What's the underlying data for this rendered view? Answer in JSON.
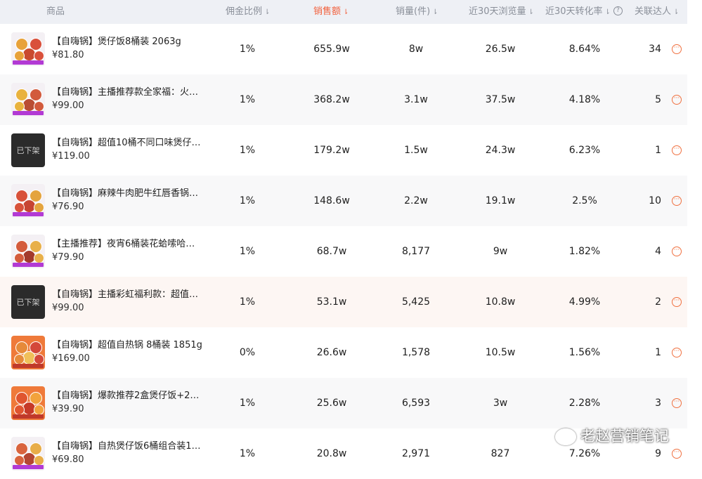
{
  "header": {
    "product": "商品",
    "commission": "佣金比例",
    "sales_amount": "销售额",
    "sales_volume": "销量(件)",
    "views_30d": "近30天浏览量",
    "conversion_30d": "近30天转化率",
    "related_kols": "关联达人"
  },
  "rows": [
    {
      "title": "【自嗨锅】煲仔饭8桶装 2063g",
      "price": "¥81.80",
      "commission": "1%",
      "sales_amount": "655.9w",
      "sales_volume": "8w",
      "views": "26.5w",
      "conversion": "8.64%",
      "kols": "34"
    },
    {
      "title": "【自嗨锅】主播推荐款全家福：火…",
      "price": "¥99.00",
      "commission": "1%",
      "sales_amount": "368.2w",
      "sales_volume": "3.1w",
      "views": "37.5w",
      "conversion": "4.18%",
      "kols": "5"
    },
    {
      "title": "【自嗨锅】超值10桶不同口味煲仔…",
      "price": "¥119.00",
      "commission": "1%",
      "sales_amount": "179.2w",
      "sales_volume": "1.5w",
      "views": "24.3w",
      "conversion": "6.23%",
      "kols": "1",
      "off_shelf": "已下架"
    },
    {
      "title": "【自嗨锅】麻辣牛肉肥牛红唇香锅…",
      "price": "¥76.90",
      "commission": "1%",
      "sales_amount": "148.6w",
      "sales_volume": "2.2w",
      "views": "19.1w",
      "conversion": "2.5%",
      "kols": "10"
    },
    {
      "title": "【主播推荐】夜宵6桶装花蛤嗦哈…",
      "price": "¥79.90",
      "commission": "1%",
      "sales_amount": "68.7w",
      "sales_volume": "8,177",
      "views": "9w",
      "conversion": "1.82%",
      "kols": "4"
    },
    {
      "title": "【自嗨锅】主播彩虹福利款：超值…",
      "price": "¥99.00",
      "commission": "1%",
      "sales_amount": "53.1w",
      "sales_volume": "5,425",
      "views": "10.8w",
      "conversion": "4.99%",
      "kols": "2",
      "off_shelf": "已下架"
    },
    {
      "title": "【自嗨锅】超值自热锅 8桶装 1851g",
      "price": "¥169.00",
      "commission": "0%",
      "sales_amount": "26.6w",
      "sales_volume": "1,578",
      "views": "10.5w",
      "conversion": "1.56%",
      "kols": "1"
    },
    {
      "title": "【自嗨锅】爆款推荐2盒煲仔饭+2…",
      "price": "¥39.90",
      "commission": "1%",
      "sales_amount": "25.6w",
      "sales_volume": "6,593",
      "views": "3w",
      "conversion": "2.28%",
      "kols": "3"
    },
    {
      "title": "【自嗨锅】自热煲仔饭6桶组合装1…",
      "price": "¥69.80",
      "commission": "1%",
      "sales_amount": "20.8w",
      "sales_volume": "2,971",
      "views": "827",
      "conversion": "7.26%",
      "kols": "9"
    }
  ],
  "watermark": "老赵营销笔记",
  "colors": {
    "accent": "#f2603c",
    "header_bg": "#eef0f5",
    "thumb_badge": "#b23ad4"
  },
  "icons": {
    "sort": "sort-down-icon",
    "help": "help-circle-icon",
    "more": "more-circle-icon",
    "wechat": "wechat-icon"
  }
}
